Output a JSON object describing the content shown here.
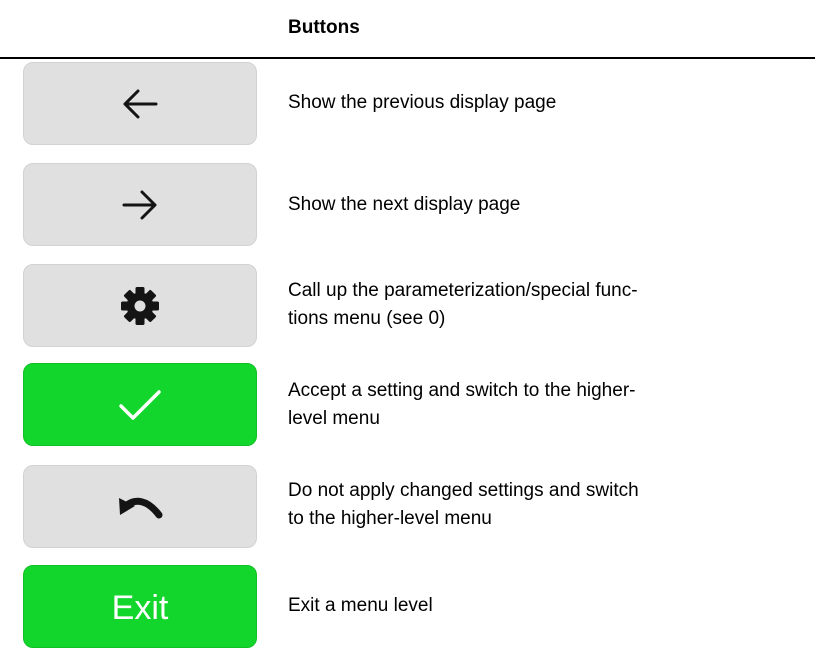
{
  "header": {
    "title": "Buttons"
  },
  "rows": [
    {
      "icon": "arrow-left-icon",
      "description": "Show the previous display page"
    },
    {
      "icon": "arrow-right-icon",
      "description": "Show the next display page"
    },
    {
      "icon": "gear-icon",
      "description": "Call up the parameterization/special func-\ntions menu (see 0)"
    },
    {
      "icon": "checkmark-icon",
      "description": "Accept a setting and switch to the higher-\nlevel menu"
    },
    {
      "icon": "undo-icon",
      "description": "Do not apply changed settings and switch\nto the higher-level menu"
    },
    {
      "button_label": "Exit",
      "description": "Exit a menu level"
    }
  ],
  "colors": {
    "grey_button": "#e0e0e0",
    "green_button": "#13d62c",
    "icon_dark": "#141414",
    "icon_light": "#ffffff"
  }
}
